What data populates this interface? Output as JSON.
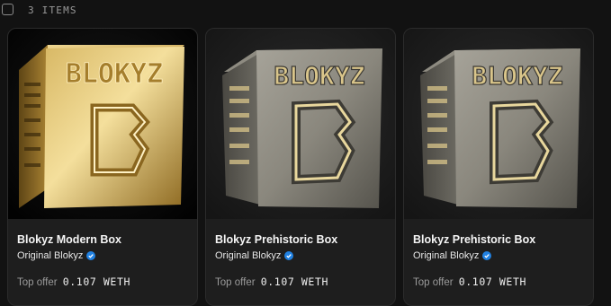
{
  "header": {
    "items_count": "3 ITEMS"
  },
  "colors": {
    "gold": "#c9a449",
    "stone": "#8f8d84",
    "verified_blue": "#2081e2"
  },
  "cards": [
    {
      "name": "Blokyz Modern Box",
      "collection": "Original Blokyz",
      "offer_label": "Top offer",
      "offer_price": "0.107 WETH",
      "image_text": "BLOKYZ",
      "material": "gold"
    },
    {
      "name": "Blokyz Prehistoric Box",
      "collection": "Original Blokyz",
      "offer_label": "Top offer",
      "offer_price": "0.107 WETH",
      "image_text": "BLOKYZ",
      "material": "stone"
    },
    {
      "name": "Blokyz Prehistoric Box",
      "collection": "Original Blokyz",
      "offer_label": "Top offer",
      "offer_price": "0.107 WETH",
      "image_text": "BLOKYZ",
      "material": "stone"
    }
  ]
}
